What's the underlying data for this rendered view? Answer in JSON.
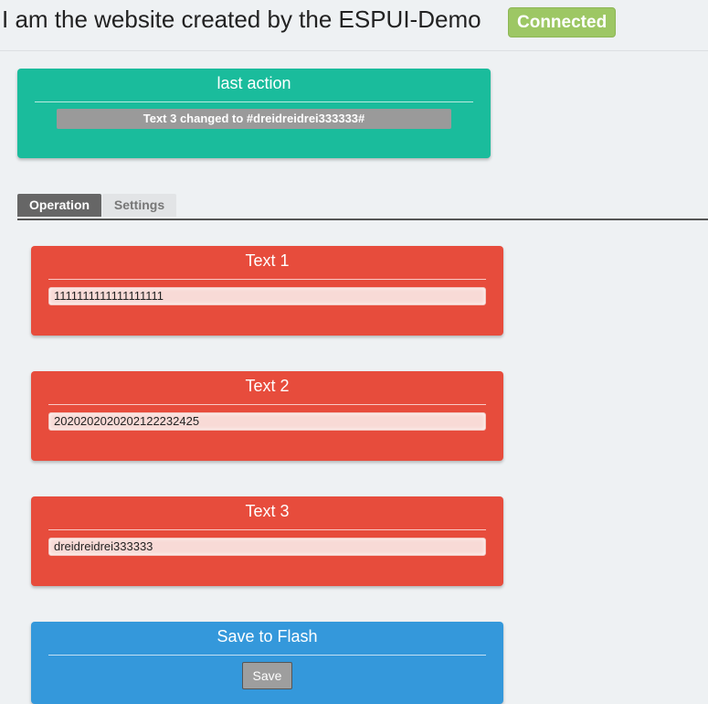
{
  "header": {
    "title": "I am the website created by the ESPUI-Demo",
    "status": "Connected"
  },
  "label_card": {
    "title": "last action",
    "value": "Text 3 changed to #dreidreidrei333333#"
  },
  "tabs": [
    {
      "label": "Operation",
      "active": true
    },
    {
      "label": "Settings",
      "active": false
    }
  ],
  "text_cards": [
    {
      "title": "Text 1",
      "value": "1111111111111111111"
    },
    {
      "title": "Text 2",
      "value": "2020202020202122232425"
    },
    {
      "title": "Text 3",
      "value": "dreidreidrei333333"
    }
  ],
  "save_card": {
    "title": "Save to Flash",
    "button_label": "Save"
  },
  "colors": {
    "background": "#eef1f3",
    "label_card": "#1abc9c",
    "text_card": "#e74c3c",
    "save_card": "#3498db",
    "status_badge": "#9dc764"
  }
}
